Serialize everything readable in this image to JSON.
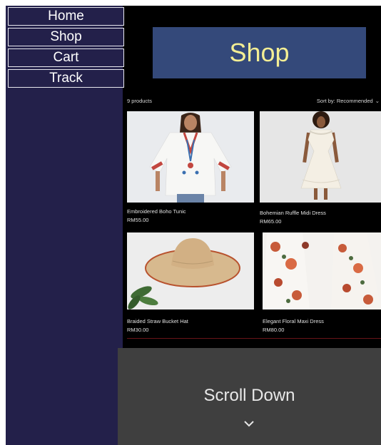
{
  "nav": {
    "items": [
      {
        "label": "Home"
      },
      {
        "label": "Shop"
      },
      {
        "label": "Cart"
      },
      {
        "label": "Track"
      }
    ]
  },
  "shop": {
    "banner_title": "Shop",
    "product_count": "9 products",
    "sort_label": "Sort by: Recommended"
  },
  "products": [
    {
      "name": "Embroidered Boho Tunic",
      "price": "RM55.00"
    },
    {
      "name": "Bohemian Ruffle Midi Dress",
      "price": "RM65.00"
    },
    {
      "name": "Braided Straw Bucket Hat",
      "price": "RM30.00"
    },
    {
      "name": "Elegant Floral Maxi Dress",
      "price": "RM80.00"
    }
  ],
  "footer": {
    "scroll_label": "Scroll Down",
    "chevron_icon": "chevron-down-icon"
  },
  "colors": {
    "sidebar": "#23204a",
    "banner": "#34497a",
    "banner_text": "#f4ee94",
    "scroll_panel": "#3f3f3f"
  }
}
